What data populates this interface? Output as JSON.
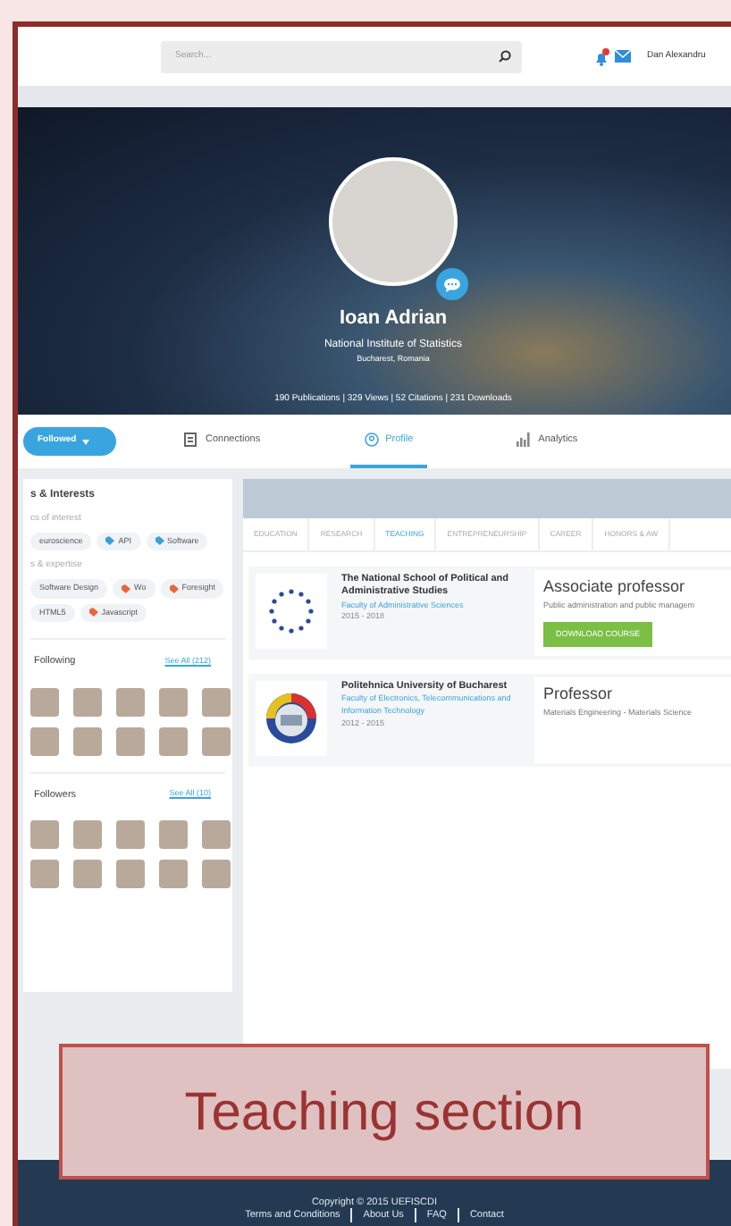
{
  "header": {
    "search": {
      "placeholder": "Search..."
    },
    "user_name": "Dan Alexandru"
  },
  "profile": {
    "name": "Ioan Adrian",
    "institution": "National Institute of Statistics",
    "location": "Bucharest, Romania",
    "stats": "190 Publications | 329 Views | 52 Citations | 231 Downloads"
  },
  "nav": {
    "follow_button": "Followed",
    "tabs": [
      {
        "label": "Connections",
        "selected": false,
        "kind": "connections"
      },
      {
        "label": "Profile",
        "selected": true,
        "kind": "profile"
      },
      {
        "label": "Analytics",
        "selected": false,
        "kind": "analytics"
      }
    ]
  },
  "sidebar": {
    "title": "s & Interests",
    "groups": [
      {
        "title": "cs of interest",
        "tags": [
          {
            "label": "euroscience"
          },
          {
            "label": "API",
            "color": "#3aa0d8"
          },
          {
            "label": "Software",
            "color": "#3aa0d8"
          }
        ]
      },
      {
        "title": "s & expertise",
        "tags": [
          {
            "label": "Software Design"
          },
          {
            "label": "Wo",
            "color": "#e8663a"
          },
          {
            "label": "Foresight",
            "color": "#e8663a"
          },
          {
            "label": "HTML5"
          },
          {
            "label": "Javascript",
            "color": "#e8663a"
          }
        ]
      }
    ],
    "people": [
      {
        "title": "Following",
        "see_all": "See All (212)"
      },
      {
        "title": "Followers",
        "see_all": "See All (10)"
      }
    ]
  },
  "teaching": {
    "tabs": [
      {
        "label": "EDUCATION",
        "selected": false
      },
      {
        "label": "RESEARCH",
        "selected": false
      },
      {
        "label": "TEACHING",
        "selected": true
      },
      {
        "label": "ENTREPRENEURSHIP",
        "selected": false
      },
      {
        "label": "CAREER",
        "selected": false
      },
      {
        "label": "HONORS & AW",
        "selected": false
      }
    ],
    "entries": [
      {
        "kind": "stars",
        "school": "The National School of Political and Administrative Studies",
        "faculty": "Faculty of Administrative Sciences",
        "years": "2015 - 2018",
        "position": "Associate professor",
        "field": "Public administration and public managem",
        "button": "DOWNLOAD COURSE"
      },
      {
        "kind": "seal",
        "school": "Politehnica University of Bucharest",
        "faculty": "Faculty of Electronics, Telecommunications and Information Technology",
        "years": "2012 - 2015",
        "position": "Professor",
        "field": "Materials Engineering - Materials Science"
      }
    ]
  },
  "annotation": "Teaching section",
  "footer": {
    "copyright": "Copyright © 2015 UEFISCDI",
    "links": [
      "Terms and Conditions",
      "About Us",
      "FAQ",
      "Contact"
    ]
  }
}
